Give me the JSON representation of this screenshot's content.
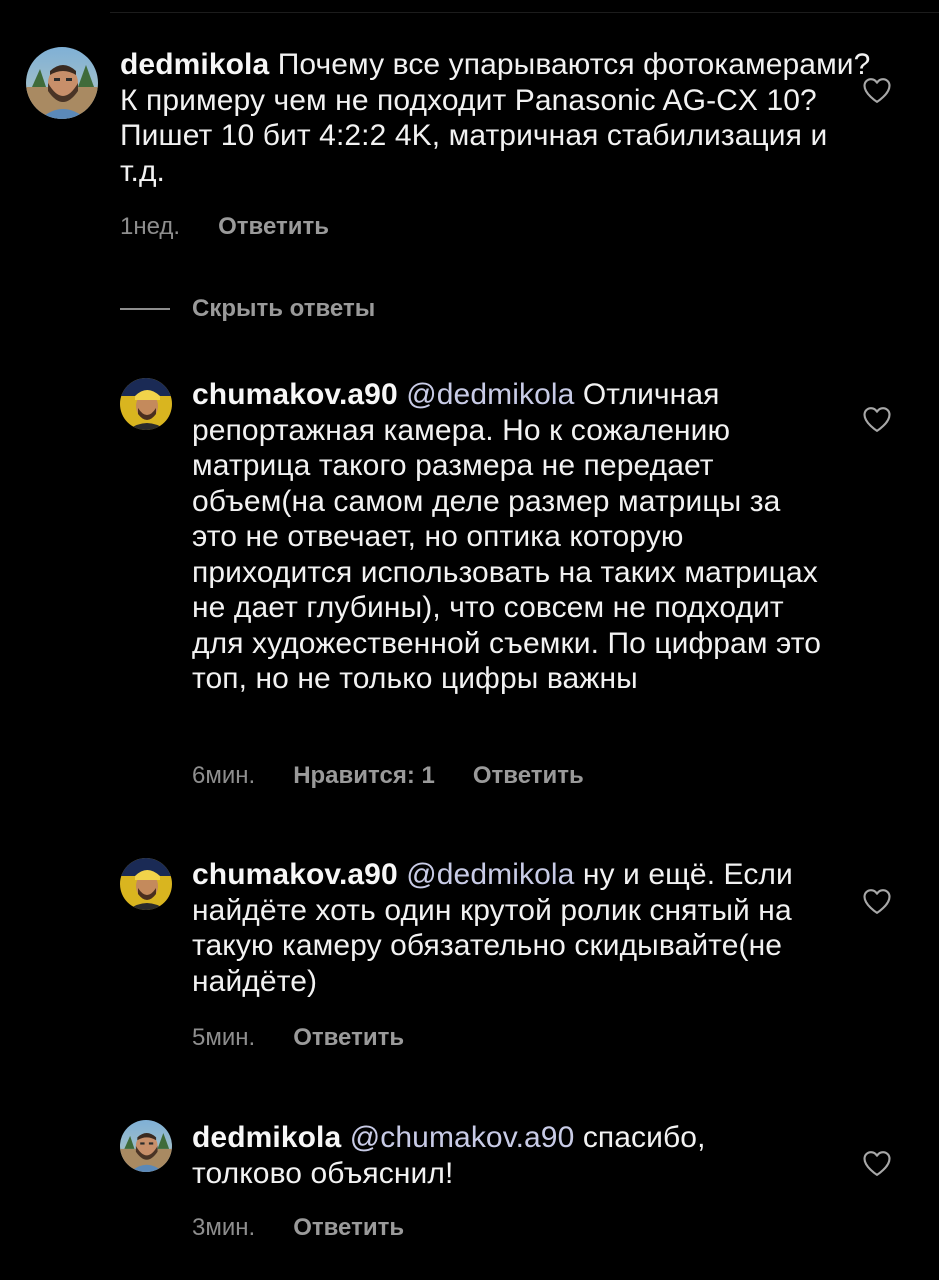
{
  "comments": [
    {
      "username": "dedmikola",
      "mention": "",
      "text": "Почему все упарываются фотокамерами? К примеру чем не подходит Panasonic AG-CX 10? Пишет 10 бит 4:2:2 4K, матричная стабилизация и т.д.",
      "time": "1нед.",
      "likes": "",
      "reply": "Ответить",
      "like_icon": "heart-outline-icon"
    },
    {
      "username": "chumakov.a90",
      "mention": "@dedmikola",
      "text": "Отличная репортажная камера. Но к сожалению матрица такого размера не передает объем(на самом деле размер матрицы за это не отвечает, но оптика которую приходится использовать на таких матрицах не дает глубины), что совсем не подходит для художественной съемки. По цифрам это топ, но не только цифры важны",
      "time": "6мин.",
      "likes": "Нравится: 1",
      "reply": "Ответить",
      "like_icon": "heart-outline-icon"
    },
    {
      "username": "chumakov.a90",
      "mention": "@dedmikola",
      "text": "ну и ещё. Если найдёте хоть один крутой ролик снятый на такую камеру обязательно скидывайте(не найдёте)",
      "time": "5мин.",
      "likes": "",
      "reply": "Ответить",
      "like_icon": "heart-outline-icon"
    },
    {
      "username": "dedmikola",
      "mention": "@chumakov.a90",
      "text": "спасибо, толково объяснил!",
      "time": "3мин.",
      "likes": "",
      "reply": "Ответить",
      "like_icon": "heart-outline-icon"
    }
  ],
  "replies_toggle": {
    "label": "Скрыть ответы"
  },
  "colors": {
    "background": "#000000",
    "text": "#f2f2f2",
    "secondary": "#8e8e8e",
    "mention": "#c8cbe6"
  }
}
